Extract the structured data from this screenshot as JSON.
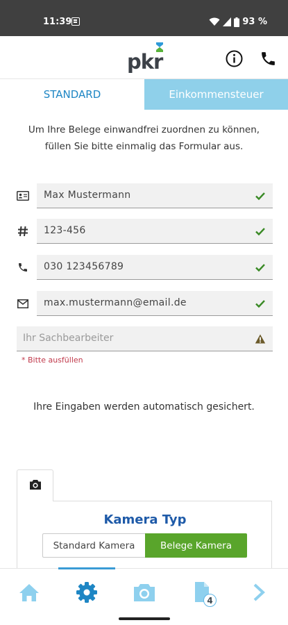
{
  "status_bar": {
    "time": "11:39",
    "battery": "93 %",
    "icons": [
      "notification-icon",
      "wifi-icon",
      "signal-icon",
      "battery-icon"
    ]
  },
  "header": {
    "logo_text": "pkr",
    "icons": [
      "info-icon",
      "phone-icon"
    ],
    "brand_colors": {
      "dark": "#3c4148",
      "blue": "#1e86c4",
      "green": "#59a52b"
    }
  },
  "tabs": [
    {
      "label": "STANDARD",
      "active": true
    },
    {
      "label": "Einkommensteuer",
      "active": false
    }
  ],
  "intro": {
    "line1": "Um Ihre Belege einwandfrei zuordnen zu können,",
    "line2": "füllen Sie bitte einmalig das Formular aus."
  },
  "form": {
    "fields": [
      {
        "icon": "id-card-icon",
        "value": "Max Mustermann",
        "status": "valid"
      },
      {
        "icon": "hash-icon",
        "value": "123-456",
        "status": "valid"
      },
      {
        "icon": "phone-icon",
        "value": "030 123456789",
        "status": "valid"
      },
      {
        "icon": "envelope-icon",
        "value": "max.mustermann@email.de",
        "status": "valid"
      }
    ],
    "sachbearbeiter": {
      "placeholder": "Ihr Sachbearbeiter",
      "status": "warning",
      "error": "* Bitte ausfüllen"
    }
  },
  "autosave_note": "Ihre Eingaben werden automatisch gesichert.",
  "camera_card": {
    "tab_icon": "camera-icon",
    "title": "Kamera Typ",
    "options": [
      {
        "label": "Standard Kamera",
        "selected": false
      },
      {
        "label": "Belege Kamera",
        "selected": true
      }
    ]
  },
  "bottom_nav": {
    "items": [
      {
        "icon": "home-icon",
        "active": false
      },
      {
        "icon": "gear-icon",
        "active": true
      },
      {
        "icon": "camera-icon",
        "active": false
      },
      {
        "icon": "documents-icon",
        "active": false,
        "badge": "4"
      },
      {
        "icon": "chevron-right-icon",
        "active": false
      }
    ]
  }
}
